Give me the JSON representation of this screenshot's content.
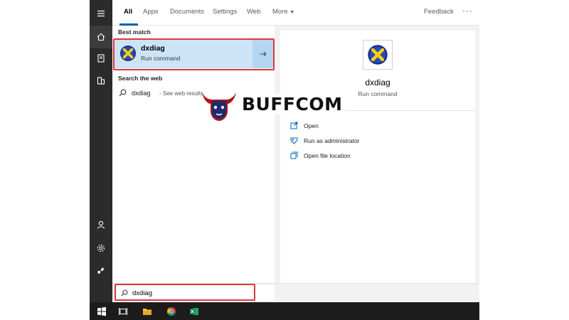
{
  "tabs": {
    "all": "All",
    "apps": "Apps",
    "documents": "Documents",
    "settings": "Settings",
    "web": "Web",
    "more": "More",
    "feedback": "Feedback"
  },
  "results": {
    "best_match_heading": "Best match",
    "best_match": {
      "title": "dxdiag",
      "subtitle": "Run command",
      "icon": "dxdiag-icon"
    },
    "web_heading": "Search the web",
    "web_item": {
      "term": "dxdiag",
      "hint": "- See web results"
    }
  },
  "detail": {
    "title": "dxdiag",
    "subtitle": "Run command",
    "actions": [
      {
        "label": "Open",
        "icon": "open-icon"
      },
      {
        "label": "Run as administrator",
        "icon": "shield-icon"
      },
      {
        "label": "Open file location",
        "icon": "folder-icon"
      }
    ]
  },
  "search": {
    "value": "dxdiag"
  },
  "rail": [
    "hamburger-icon",
    "home-icon",
    "documents-icon",
    "building-icon",
    "user-icon",
    "settings-icon",
    "feedback-icon"
  ],
  "taskbar": [
    "windows-start-icon",
    "task-view-icon",
    "file-explorer-icon",
    "chrome-icon",
    "excel-icon"
  ],
  "watermark": {
    "text": "BUFFCOM"
  },
  "colors": {
    "accent": "#0063b1",
    "selection": "#cce4f7",
    "highlight_box": "#e0383a",
    "rail": "#2b2b2b",
    "taskbar": "#1c1c1c"
  }
}
